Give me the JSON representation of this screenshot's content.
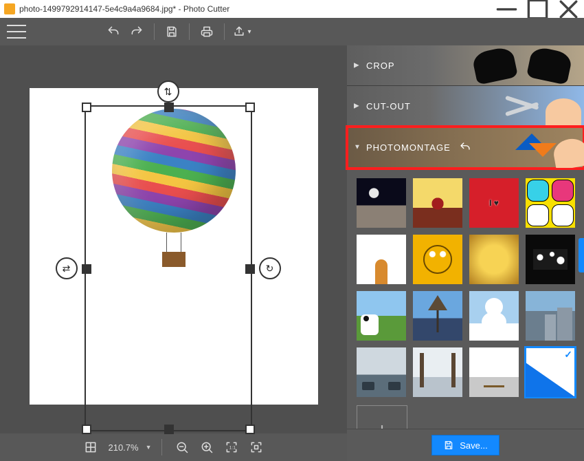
{
  "titlebar": {
    "title": "photo-1499792914147-5e4c9a4a9684.jpg* - Photo Cutter"
  },
  "panels": {
    "crop": {
      "label": "CROP"
    },
    "cutout": {
      "label": "CUT-OUT"
    },
    "photomontage": {
      "label": "PHOTOMONTAGE"
    }
  },
  "thumbs": {
    "selected_index": 15,
    "items": [
      {
        "name": "moon"
      },
      {
        "name": "tree-sunset"
      },
      {
        "name": "i-heart"
      },
      {
        "name": "comic"
      },
      {
        "name": "dog"
      },
      {
        "name": "monster"
      },
      {
        "name": "bokeh-gold"
      },
      {
        "name": "paparazzi"
      },
      {
        "name": "cow"
      },
      {
        "name": "eiffel"
      },
      {
        "name": "snowman"
      },
      {
        "name": "city"
      },
      {
        "name": "gondola"
      },
      {
        "name": "winter-trees"
      },
      {
        "name": "pier"
      },
      {
        "name": "blank-blue"
      }
    ]
  },
  "bottom": {
    "zoom": "210.7%"
  },
  "save": {
    "label": "Save..."
  }
}
